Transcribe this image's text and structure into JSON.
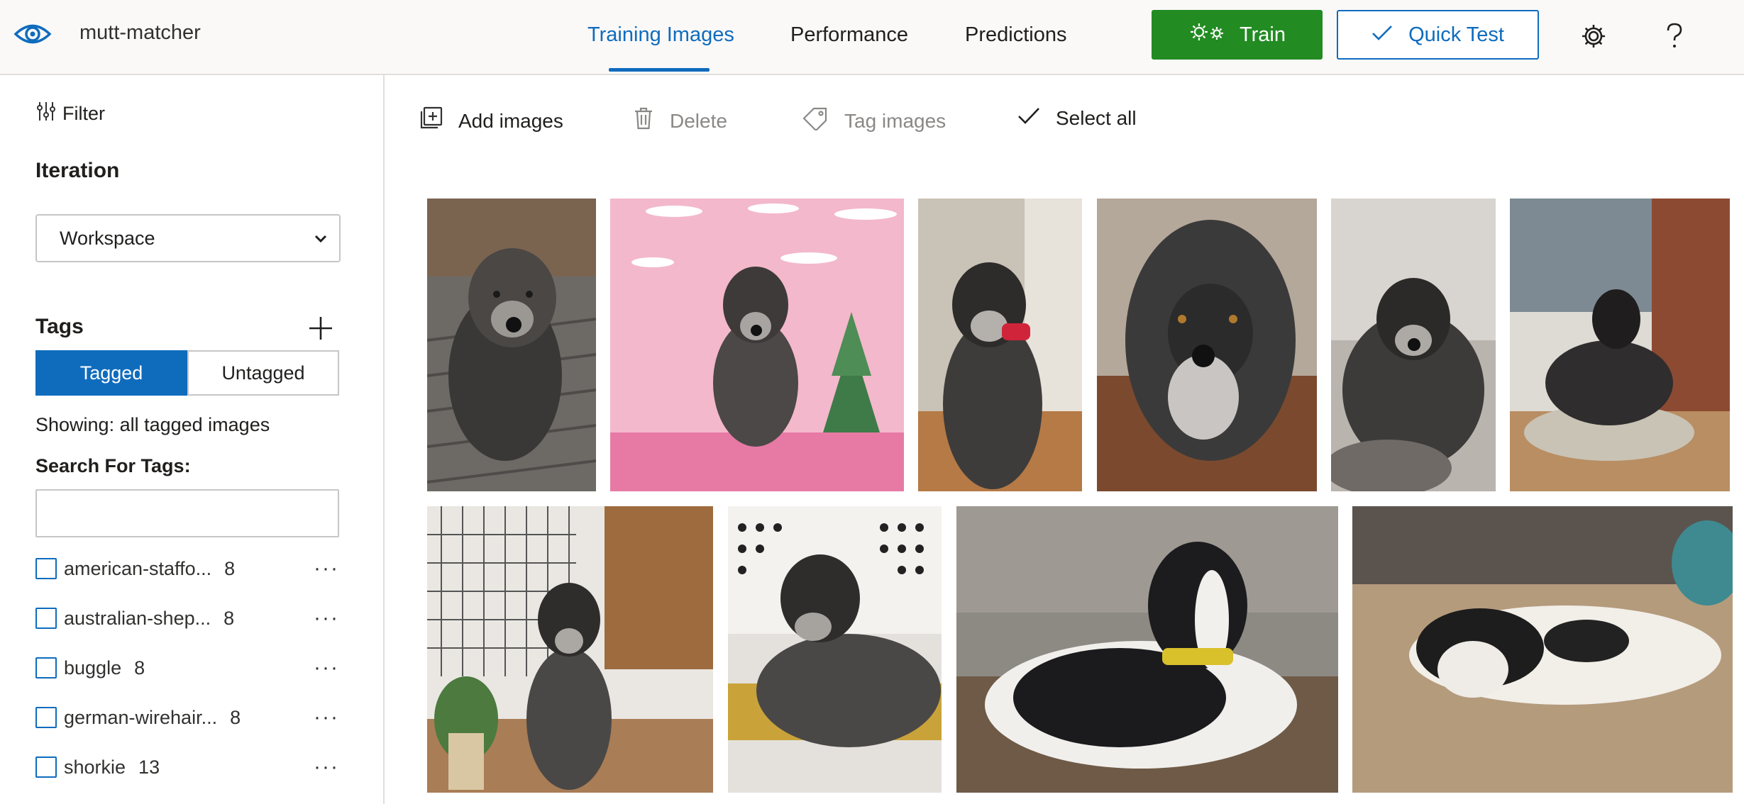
{
  "app": {
    "name": "mutt-matcher"
  },
  "nav": {
    "tabs": [
      {
        "label": "Training Images",
        "active": true
      },
      {
        "label": "Performance",
        "active": false
      },
      {
        "label": "Predictions",
        "active": false
      }
    ],
    "train_label": "Train",
    "quick_test_label": "Quick Test"
  },
  "sidebar": {
    "filter_label": "Filter",
    "iteration_title": "Iteration",
    "iteration_value": "Workspace",
    "tags_title": "Tags",
    "tagged_label": "Tagged",
    "untagged_label": "Untagged",
    "showing_text": "Showing: all tagged images",
    "search_label": "Search For Tags:",
    "search_value": "",
    "tags": [
      {
        "name": "american-staffo...",
        "count": "8"
      },
      {
        "name": "australian-shep...",
        "count": "8"
      },
      {
        "name": "buggle",
        "count": "8"
      },
      {
        "name": "german-wirehair...",
        "count": "8"
      },
      {
        "name": "shorkie",
        "count": "13"
      }
    ]
  },
  "toolbar": {
    "add_images": "Add images",
    "delete": "Delete",
    "tag_images": "Tag images",
    "select_all": "Select all"
  },
  "colors": {
    "accent": "#0f6cbd",
    "train_green": "#228b22",
    "header_bg": "#faf9f8"
  },
  "icons": [
    "eye-logo-icon",
    "gears-icon",
    "checkmark-icon",
    "settings-gear-icon",
    "help-question-icon",
    "filter-sliders-icon",
    "chevron-down-icon",
    "plus-icon",
    "add-image-icon",
    "trash-icon",
    "tag-icon",
    "more-dots-icon"
  ]
}
